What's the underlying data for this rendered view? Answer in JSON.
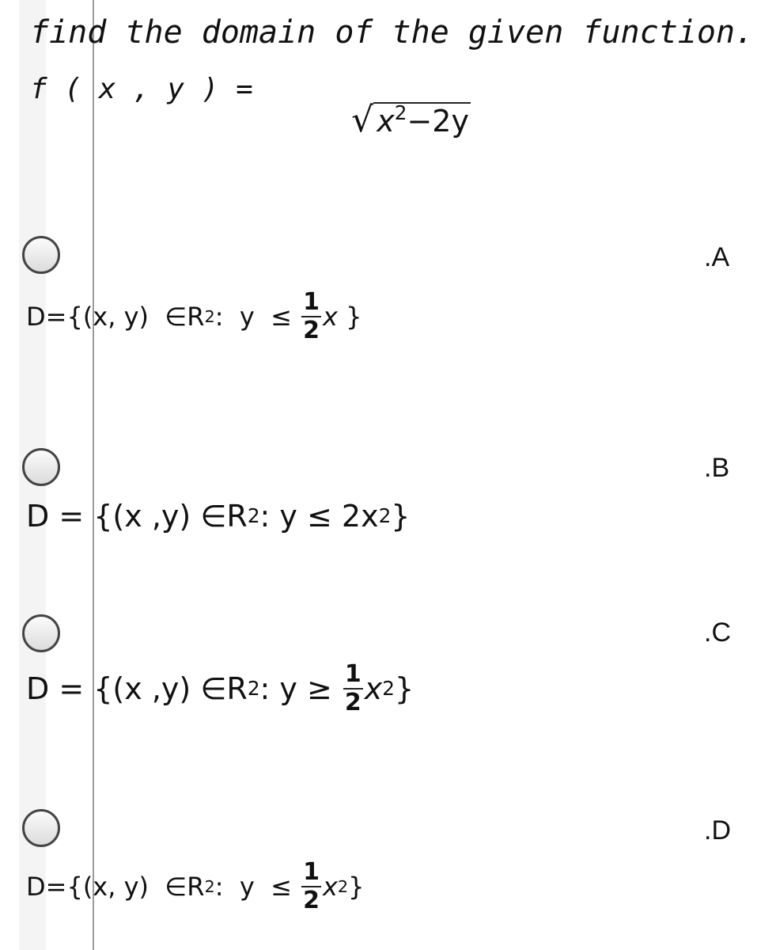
{
  "question": {
    "title": "find the domain of the given function.",
    "function_lhs": "f ( x , y ) =",
    "sqrt_symbol": "√",
    "radicand_base": "x",
    "radicand_exp": "2",
    "radicand_rest": "−2y"
  },
  "options": [
    {
      "letter": ".A",
      "prefix": "D={(x, y)  ∈R",
      "exp": "2",
      "mid": ":  y  ≤ ",
      "frac_num": "1",
      "frac_den": "2",
      "var": "x",
      "var_exp": "",
      "suffix": " }"
    },
    {
      "letter": ".B",
      "prefix": "D = {(x ,y) ∈R",
      "exp": "2",
      "mid": ": y ≤ 2x",
      "var_exp": "2",
      "suffix": "}"
    },
    {
      "letter": ".C",
      "prefix": "D = {(x ,y) ∈R",
      "exp": "2",
      "mid": ": y ≥ ",
      "frac_num": "1",
      "frac_den": "2",
      "var": "x",
      "var_exp": "2",
      "suffix": "}"
    },
    {
      "letter": ".D",
      "prefix": "D={(x, y)  ∈R",
      "exp": "2",
      "mid": ":  y  ≤ ",
      "frac_num": "1",
      "frac_den": "2",
      "var": "x",
      "var_exp": "2",
      "suffix": "}"
    }
  ]
}
